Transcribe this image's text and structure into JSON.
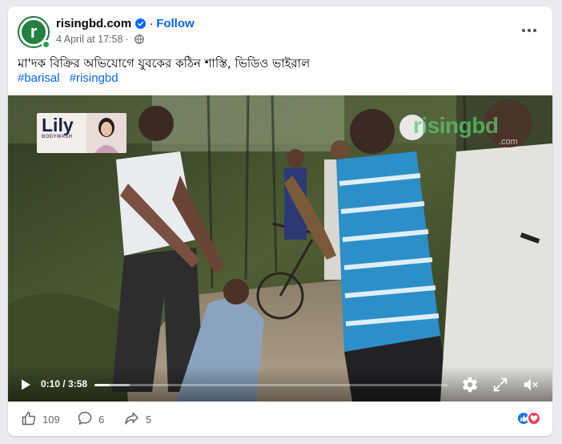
{
  "post": {
    "page_name": "risingbd.com",
    "follow_label": "Follow",
    "timestamp": "4 April at 17:58",
    "dot": "·",
    "caption": "মা'দক বিক্রির অভিযোগে যুবকের কঠিন শাস্তি, ভিডিও ভাইরাল",
    "hashtags": [
      "#barisal",
      "#risingbd"
    ],
    "avatar_letter": "r"
  },
  "video": {
    "sponsor_logo": "Lily",
    "sponsor_sub": "BODYWASH",
    "watermark": "risingbd",
    "watermark_sub": ".com",
    "time_label": "0:10 / 3:58",
    "progress": 0.042,
    "buffered": 0.1
  },
  "footer": {
    "likes": "109",
    "comments": "6",
    "shares": "5"
  },
  "colors": {
    "accent": "#0866ff",
    "like_blue": "#1877f2",
    "love_red": "#f33e58",
    "brand_green": "#23803f"
  },
  "icons": {
    "verified": "verified-badge-icon",
    "globe": "globe-icon",
    "more": "more-options-icon",
    "play": "play-icon",
    "settings": "gear-icon",
    "fullscreen": "fullscreen-icon",
    "mute": "volume-muted-icon",
    "like": "thumbs-up-icon",
    "comment": "comment-icon",
    "share": "share-icon"
  }
}
